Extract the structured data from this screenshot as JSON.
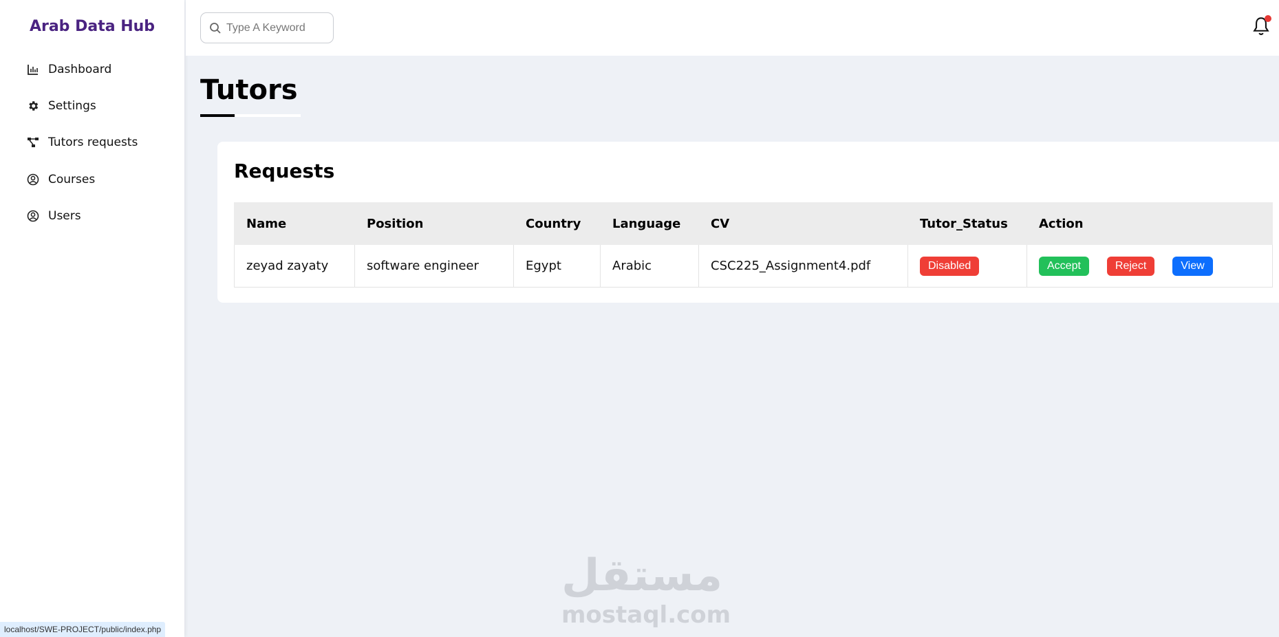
{
  "sidebar": {
    "brand": "Arab Data Hub",
    "items": [
      {
        "label": "Dashboard",
        "icon": "bar-chart-icon"
      },
      {
        "label": "Settings",
        "icon": "gear-icon"
      },
      {
        "label": "Tutors requests",
        "icon": "network-icon"
      },
      {
        "label": "Courses",
        "icon": "user-circle-icon"
      },
      {
        "label": "Users",
        "icon": "user-circle-icon"
      }
    ]
  },
  "header": {
    "search_placeholder": "Type A Keyword",
    "notification_icon": "bell-icon",
    "notification_dot_color": "#e53935"
  },
  "page": {
    "title": "Tutors"
  },
  "requests": {
    "title": "Requests",
    "columns": [
      "Name",
      "Position",
      "Country",
      "Language",
      "CV",
      "Tutor_Status",
      "Action"
    ],
    "rows": [
      {
        "name": "zeyad zayaty",
        "position": "software engineer",
        "country": "Egypt",
        "language": "Arabic",
        "cv": "CSC225_Assignment4.pdf",
        "status": "Disabled",
        "actions": {
          "accept": "Accept",
          "reject": "Reject",
          "view": "View"
        }
      }
    ]
  },
  "colors": {
    "brand": "#4a2381",
    "disabled": "#ef3e36",
    "accept": "#22c05a",
    "reject": "#ef3e36",
    "view": "#0d6efd"
  },
  "status_bar": {
    "url": "localhost/SWE-PROJECT/public/index.php"
  },
  "watermark": {
    "arabic": "مستقل",
    "latin": "mostaql.com"
  }
}
